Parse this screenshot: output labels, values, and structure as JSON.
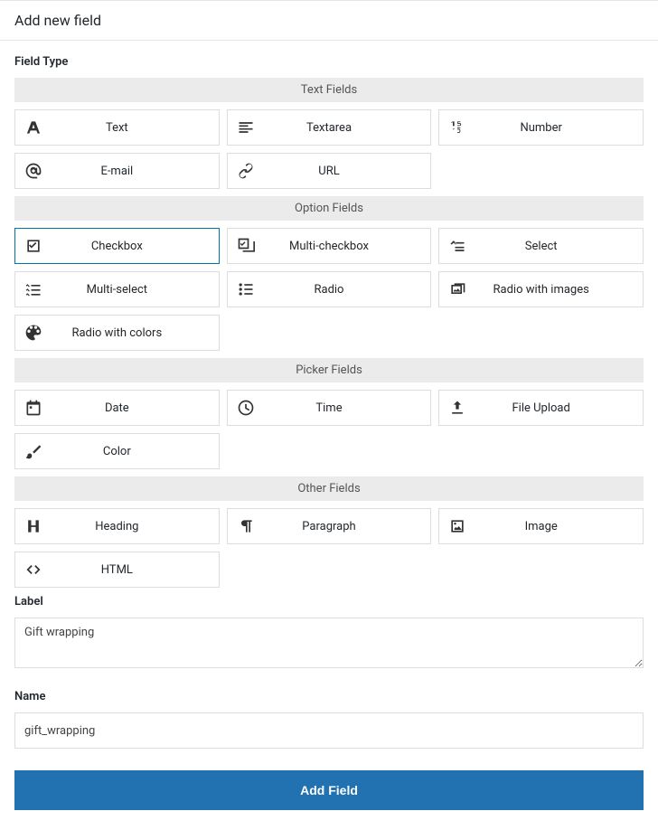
{
  "header": "Add new field",
  "fieldTypeLabel": "Field Type",
  "groups": [
    {
      "title": "Text Fields",
      "items": [
        {
          "id": "text",
          "label": "Text",
          "icon": "font",
          "selected": false
        },
        {
          "id": "textarea",
          "label": "Textarea",
          "icon": "align-left",
          "selected": false
        },
        {
          "id": "number",
          "label": "Number",
          "icon": "number",
          "selected": false
        },
        {
          "id": "email",
          "label": "E-mail",
          "icon": "at",
          "selected": false
        },
        {
          "id": "url",
          "label": "URL",
          "icon": "link",
          "selected": false
        }
      ]
    },
    {
      "title": "Option Fields",
      "items": [
        {
          "id": "checkbox",
          "label": "Checkbox",
          "icon": "check-square",
          "selected": true
        },
        {
          "id": "multi-checkbox",
          "label": "Multi-checkbox",
          "icon": "multi-check",
          "selected": false
        },
        {
          "id": "select",
          "label": "Select",
          "icon": "select",
          "selected": false
        },
        {
          "id": "multi-select",
          "label": "Multi-select",
          "icon": "multi-list",
          "selected": false
        },
        {
          "id": "radio",
          "label": "Radio",
          "icon": "radio-list",
          "selected": false
        },
        {
          "id": "radio-images",
          "label": "Radio with images",
          "icon": "images",
          "selected": false
        },
        {
          "id": "radio-colors",
          "label": "Radio with colors",
          "icon": "palette",
          "selected": false
        }
      ]
    },
    {
      "title": "Picker Fields",
      "items": [
        {
          "id": "date",
          "label": "Date",
          "icon": "calendar",
          "selected": false
        },
        {
          "id": "time",
          "label": "Time",
          "icon": "clock",
          "selected": false
        },
        {
          "id": "file",
          "label": "File Upload",
          "icon": "upload",
          "selected": false
        },
        {
          "id": "color",
          "label": "Color",
          "icon": "brush",
          "selected": false
        }
      ]
    },
    {
      "title": "Other Fields",
      "items": [
        {
          "id": "heading",
          "label": "Heading",
          "icon": "heading",
          "selected": false
        },
        {
          "id": "paragraph",
          "label": "Paragraph",
          "icon": "pilcrow",
          "selected": false
        },
        {
          "id": "image",
          "label": "Image",
          "icon": "image",
          "selected": false
        },
        {
          "id": "html",
          "label": "HTML",
          "icon": "code",
          "selected": false
        }
      ]
    }
  ],
  "labelField": {
    "label": "Label",
    "value": "Gift wrapping"
  },
  "nameField": {
    "label": "Name",
    "value": "gift_wrapping"
  },
  "submitLabel": "Add Field"
}
